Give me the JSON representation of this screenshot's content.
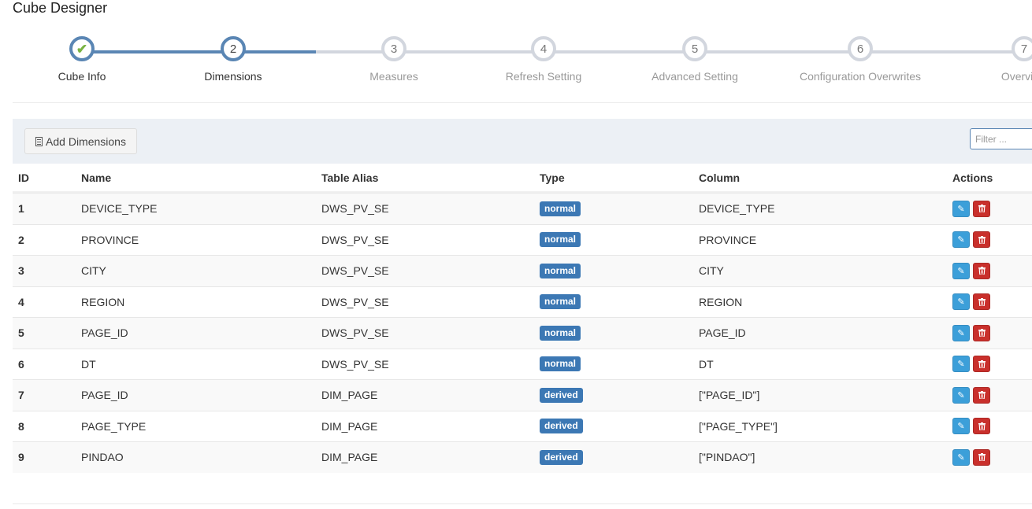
{
  "page": {
    "title": "Cube Designer"
  },
  "wizard": {
    "progress_steps_completed": 2,
    "steps": [
      {
        "number": "",
        "label": "Cube Info",
        "state": "done",
        "icon": "check-icon"
      },
      {
        "number": "2",
        "label": "Dimensions",
        "state": "active"
      },
      {
        "number": "3",
        "label": "Measures",
        "state": "pending"
      },
      {
        "number": "4",
        "label": "Refresh Setting",
        "state": "pending"
      },
      {
        "number": "5",
        "label": "Advanced Setting",
        "state": "pending"
      },
      {
        "number": "6",
        "label": "Configuration Overwrites",
        "state": "pending"
      },
      {
        "number": "7",
        "label": "Overview",
        "state": "pending"
      }
    ]
  },
  "toolbar": {
    "add_button_label": "Add Dimensions",
    "add_button_icon": "document-icon",
    "filter_placeholder": "Filter ..."
  },
  "table": {
    "columns": [
      "ID",
      "Name",
      "Table Alias",
      "Type",
      "Column",
      "Actions"
    ],
    "rows": [
      {
        "id": "1",
        "name": "DEVICE_TYPE",
        "alias": "DWS_PV_SE",
        "type": "normal",
        "column": "DEVICE_TYPE"
      },
      {
        "id": "2",
        "name": "PROVINCE",
        "alias": "DWS_PV_SE",
        "type": "normal",
        "column": "PROVINCE"
      },
      {
        "id": "3",
        "name": "CITY",
        "alias": "DWS_PV_SE",
        "type": "normal",
        "column": "CITY"
      },
      {
        "id": "4",
        "name": "REGION",
        "alias": "DWS_PV_SE",
        "type": "normal",
        "column": "REGION"
      },
      {
        "id": "5",
        "name": "PAGE_ID",
        "alias": "DWS_PV_SE",
        "type": "normal",
        "column": "PAGE_ID"
      },
      {
        "id": "6",
        "name": "DT",
        "alias": "DWS_PV_SE",
        "type": "normal",
        "column": "DT"
      },
      {
        "id": "7",
        "name": "PAGE_ID",
        "alias": "DIM_PAGE",
        "type": "derived",
        "column": "[\"PAGE_ID\"]"
      },
      {
        "id": "8",
        "name": "PAGE_TYPE",
        "alias": "DIM_PAGE",
        "type": "derived",
        "column": "[\"PAGE_TYPE\"]"
      },
      {
        "id": "9",
        "name": "PINDAO",
        "alias": "DIM_PAGE",
        "type": "derived",
        "column": "[\"PINDAO\"]"
      }
    ],
    "type_colors": {
      "normal": "#3c78b4",
      "derived": "#3c78b4"
    },
    "action_icons": {
      "edit": "pencil-icon",
      "delete": "trash-icon"
    }
  },
  "colors": {
    "accent": "#5a86b4",
    "edit": "#3c9fd9",
    "delete": "#c9302c",
    "done_check": "#7ab342"
  }
}
